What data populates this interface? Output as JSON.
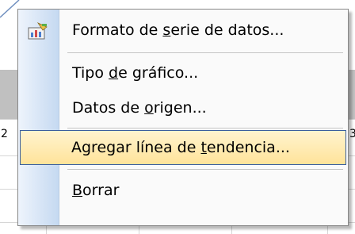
{
  "menu": {
    "items": [
      {
        "label_pre": "Formato de ",
        "label_key": "s",
        "label_post": "erie de datos...",
        "icon": "format-series-icon"
      },
      {
        "label_pre": "Tipo ",
        "label_key": "d",
        "label_post": "e gráfico...",
        "icon": null
      },
      {
        "label_pre": "Datos de ",
        "label_key": "o",
        "label_post": "rigen...",
        "icon": null
      },
      {
        "label_pre": "Agregar línea de ",
        "label_key": "t",
        "label_post": "endencia...",
        "icon": null,
        "highlighted": true
      },
      {
        "label_pre": "",
        "label_key": "B",
        "label_post": "orrar",
        "icon": null
      }
    ]
  },
  "background": {
    "left_edge_text": "2",
    "right_edge_text": "3"
  },
  "colors": {
    "highlight_fill": "#ffe39a",
    "highlight_border": "#3a5f9e",
    "gutter": "#c5d9f1"
  }
}
